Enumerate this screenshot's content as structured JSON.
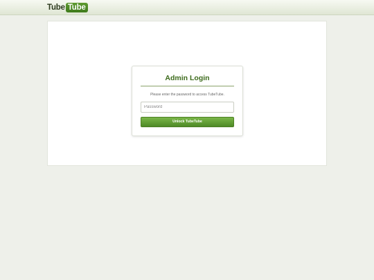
{
  "header": {
    "logo_part1": "Tube",
    "logo_part2": "Tube"
  },
  "login": {
    "title": "Admin Login",
    "description": "Please enter the password to access TubeTube.",
    "password_placeholder": "Password",
    "password_value": "",
    "unlock_label": "Unlock TubeTube"
  },
  "colors": {
    "brand_green": "#4e8a26",
    "title_green": "#3d6b1c",
    "background": "#eef0ea"
  }
}
